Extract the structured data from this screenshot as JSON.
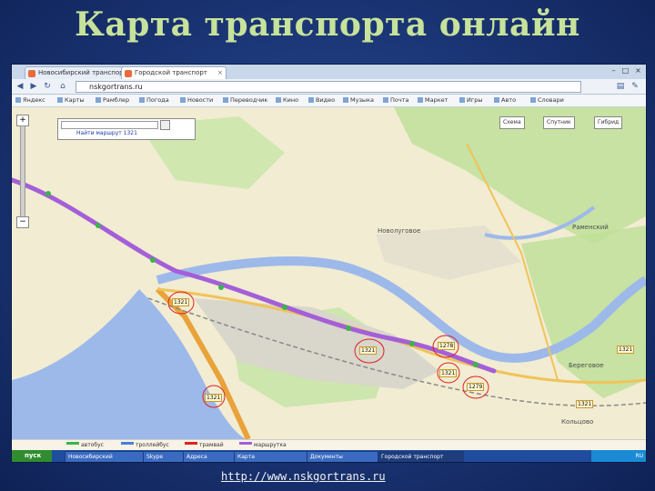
{
  "slide": {
    "title": "Карта транспорта онлайн",
    "link": "http://www.nskgortrans.ru"
  },
  "browser": {
    "tabs": [
      {
        "label": "Новосибирский транспорт"
      },
      {
        "label": "Городской транспорт"
      }
    ],
    "url": "nskgortrans.ru",
    "bookmarks": [
      "Яндекс",
      "Карты",
      "Рамблер",
      "Погода",
      "Новости",
      "Переводчик",
      "Кино",
      "Видео",
      "Музыка",
      "Почта",
      "Маркет",
      "Игры",
      "Авто",
      "Словари"
    ]
  },
  "map": {
    "search_hint": "Найти маршрут 1321",
    "map_types": [
      "Схема",
      "Спутник",
      "Гибрид"
    ],
    "places": [
      "Новолуговое",
      "Раменский",
      "Береговое",
      "Кольцово"
    ],
    "bus_labels": [
      "1321",
      "1321",
      "1321",
      "1278",
      "1321",
      "1279",
      "1321",
      "1321"
    ],
    "route_color": "#a45fd8",
    "road_color": "#e8a33a",
    "river_color": "#9db9ea",
    "forest_color": "#bfe09a"
  },
  "legend": [
    "автобус",
    "троллейбус",
    "трамвай",
    "маршрутка"
  ],
  "taskbar": {
    "start": "пуск",
    "items": [
      "Новосибирский",
      "Skype",
      "Адреса",
      "Карта",
      "Документы",
      "Городской транспорт"
    ],
    "tray_time": "RU"
  },
  "colors": {
    "title": "#c7e29a",
    "background": "#1a3474"
  }
}
